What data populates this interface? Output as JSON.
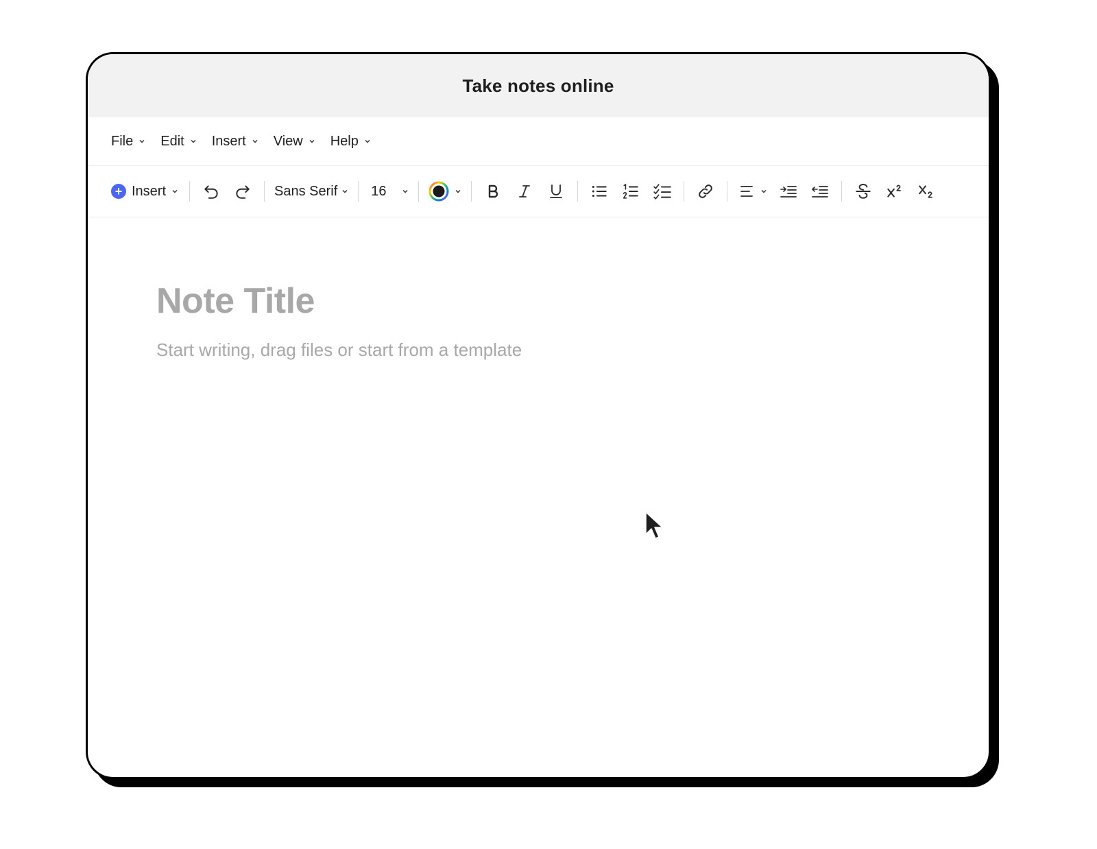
{
  "window": {
    "title": "Take notes online"
  },
  "menu": {
    "items": [
      {
        "label": "File"
      },
      {
        "label": "Edit"
      },
      {
        "label": "Insert"
      },
      {
        "label": "View"
      },
      {
        "label": "Help"
      }
    ]
  },
  "toolbar": {
    "insert_label": "Insert",
    "font_family": "Sans Serif",
    "font_size": "16",
    "text_color": "#1a1a1a",
    "accent_color": "#4a66f5"
  },
  "editor": {
    "title_placeholder": "Note Title",
    "body_placeholder": "Start writing, drag files or start from a template"
  }
}
